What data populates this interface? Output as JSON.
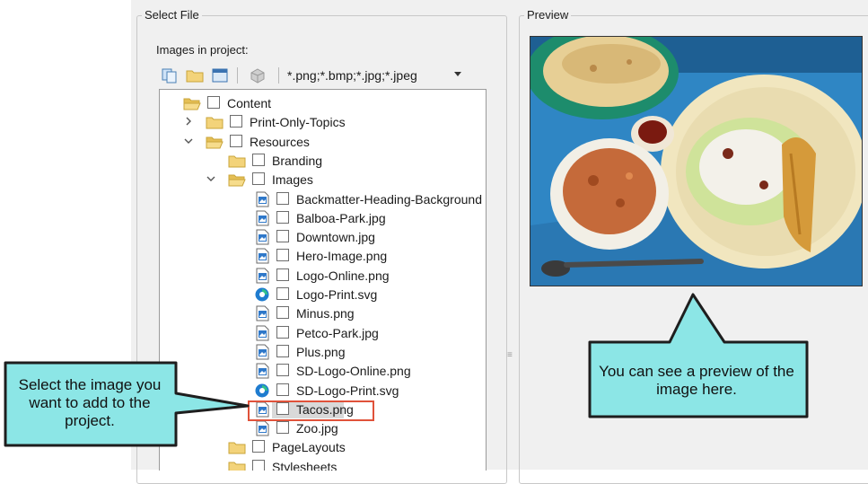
{
  "select_file": {
    "title": "Select File",
    "images_label": "Images in project:",
    "filter": "*.png;*.bmp;*.jpg;*.jpeg"
  },
  "preview": {
    "title": "Preview",
    "splitter_glyph": "≡"
  },
  "tree": [
    {
      "label": "Content",
      "icon": "folder-open-icon",
      "expander": ""
    },
    {
      "label": "Print-Only-Topics",
      "icon": "folder-icon",
      "expander": "collapsed"
    },
    {
      "label": "Resources",
      "icon": "folder-open-icon",
      "expander": "expanded"
    },
    {
      "label": "Branding",
      "icon": "folder-icon",
      "expander": ""
    },
    {
      "label": "Images",
      "icon": "folder-open-icon",
      "expander": "expanded"
    },
    {
      "label": "Backmatter-Heading-Background",
      "icon": "image-file-icon"
    },
    {
      "label": "Balboa-Park.jpg",
      "icon": "image-file-icon"
    },
    {
      "label": "Downtown.jpg",
      "icon": "image-file-icon"
    },
    {
      "label": "Hero-Image.png",
      "icon": "image-file-icon"
    },
    {
      "label": "Logo-Online.png",
      "icon": "image-file-icon"
    },
    {
      "label": "Logo-Print.svg",
      "icon": "svg-file-icon"
    },
    {
      "label": "Minus.png",
      "icon": "image-file-icon"
    },
    {
      "label": "Petco-Park.jpg",
      "icon": "image-file-icon"
    },
    {
      "label": "Plus.png",
      "icon": "image-file-icon"
    },
    {
      "label": "SD-Logo-Online.png",
      "icon": "image-file-icon"
    },
    {
      "label": "SD-Logo-Print.svg",
      "icon": "svg-file-icon"
    },
    {
      "label": "Tacos.png",
      "icon": "image-file-icon",
      "selected": true
    },
    {
      "label": "Zoo.jpg",
      "icon": "image-file-icon"
    },
    {
      "label": "PageLayouts",
      "icon": "folder-icon"
    },
    {
      "label": "Stylesheets",
      "icon": "folder-icon"
    }
  ],
  "callouts": {
    "left": "Select the image you want to add to the project.",
    "right": "You can see a preview of the image here."
  },
  "colors": {
    "callout_fill": "#8ce6e6",
    "callout_border": "#1e1e1e",
    "highlight": "#e0523a"
  }
}
